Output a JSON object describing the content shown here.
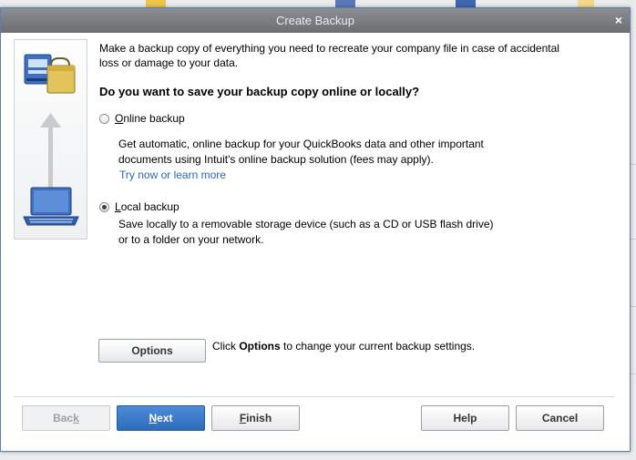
{
  "dialog": {
    "title": "Create Backup",
    "close_glyph": "×",
    "intro": "Make a backup copy of everything you need to recreate your company file in case of accidental loss or damage to your data.",
    "question": "Do you want to save your backup copy online or locally?",
    "online": {
      "label_first": "O",
      "label_rest": "nline backup",
      "selected": false,
      "desc_line1": "Get automatic, online backup for your QuickBooks data and other important",
      "desc_line2": "documents using Intuit's online backup solution (fees may apply).",
      "link": "Try now or learn more"
    },
    "local": {
      "label_first": "L",
      "label_rest": "ocal backup",
      "selected": true,
      "desc_line1": "Save locally to a removable storage device (such as a CD or USB flash drive)",
      "desc_line2": "or to a folder on your network."
    },
    "options": {
      "button": "Options",
      "hint_pre": "Click ",
      "hint_bold": "Options",
      "hint_post": " to change your current backup settings."
    },
    "buttons": {
      "back_pre": "Bac",
      "back_u": "k",
      "next_u": "N",
      "next_rest": "ext",
      "finish_u": "F",
      "finish_rest": "inish",
      "help": "Help",
      "cancel": "Cancel"
    }
  },
  "icons": {
    "illustration": [
      "computer-icon",
      "briefcase-icon",
      "arrow-up-icon",
      "laptop-icon"
    ],
    "close": "close-icon"
  },
  "colors": {
    "link": "#2c65b8",
    "primary_button": "#2f6bbb",
    "titlebar": "#7a7c80"
  }
}
